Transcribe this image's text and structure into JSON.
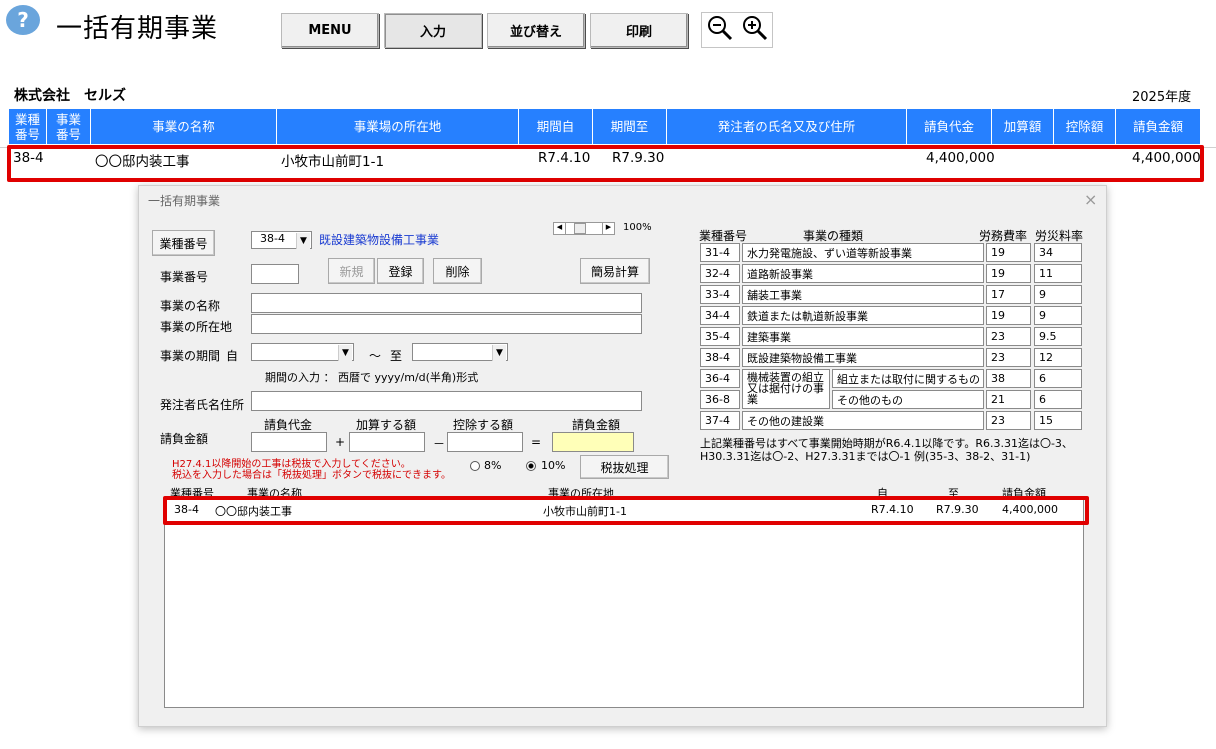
{
  "app": {
    "help_icon": "?",
    "title": "一括有期事業",
    "buttons": [
      "MENU",
      "入力",
      "並び替え",
      "印刷"
    ],
    "zoom_out_icon": "zoom-out-icon",
    "zoom_in_icon": "zoom-in-icon"
  },
  "company": "株式会社　セルズ",
  "fiscal_year": "2025年度",
  "table": {
    "headers": [
      "業種\n番号",
      "事業\n番号",
      "事業の名称",
      "事業場の所在地",
      "期間自",
      "期間至",
      "発注者の氏名又及び住所",
      "請負代金",
      "加算額",
      "控除額",
      "請負金額"
    ],
    "row": {
      "industry_no": "38-4",
      "business_name": "〇〇邸内装工事",
      "location": "小牧市山前町1-1",
      "from": "R7.4.10",
      "to": "R7.9.30",
      "contract_price": "4,400,000",
      "contract_amount": "4,400,000"
    }
  },
  "dialog": {
    "title": "一括有期事業",
    "close": "×",
    "industry_button": "業種番号",
    "industry_value": "38-4",
    "industry_name": "既設建築物設備工事業",
    "zoom_pct": "100%",
    "business_no_label": "事業番号",
    "new_button": "新規",
    "register_button": "登録",
    "delete_button": "削除",
    "simple_calc_button": "簡易計算",
    "name_label": "事業の名称",
    "location_label": "事業の所在地",
    "period_label": "事業の期間",
    "period_from": "自",
    "period_tilde": "～",
    "period_to": "至",
    "period_hint": "期間の入力 ：  西暦で  yyyy/m/d(半角)形式",
    "client_label": "発注者氏名住所",
    "amount_label": "請負金額",
    "col_contract": "請負代金",
    "col_add": "加算する額",
    "col_deduct": "控除する額",
    "col_total": "請負金額",
    "op_plus": "+",
    "op_minus": "－",
    "op_eq": "=",
    "tax_note_1": "H27.4.1以降開始の工事は税抜で入力してください。",
    "tax_note_2": "税込を入力した場合は「税抜処理」ボタンで税抜にできます。",
    "radio_8": "8%",
    "radio_10": "10%",
    "tax_button": "税抜処理",
    "code_table": {
      "headers": [
        "業種番号",
        "事業の種類",
        "労務費率",
        "労災料率"
      ],
      "rows": [
        {
          "code": "31-4",
          "name": "水力発電施設、ずい道等新設事業",
          "labor": "19",
          "rate": "34"
        },
        {
          "code": "32-4",
          "name": "道路新設事業",
          "labor": "19",
          "rate": "11"
        },
        {
          "code": "33-4",
          "name": "舗装工事業",
          "labor": "17",
          "rate": "9"
        },
        {
          "code": "34-4",
          "name": "鉄道または軌道新設事業",
          "labor": "19",
          "rate": "9"
        },
        {
          "code": "35-4",
          "name": "建築事業",
          "labor": "23",
          "rate": "9.5"
        },
        {
          "code": "38-4",
          "name": "既設建築物設備工事業",
          "labor": "23",
          "rate": "12"
        },
        {
          "code": "36-4",
          "name": "組立または取付に関するもの",
          "labor": "38",
          "rate": "6"
        },
        {
          "code": "36-8",
          "name": "その他のもの",
          "labor": "21",
          "rate": "6"
        },
        {
          "code": "37-4",
          "name": "その他の建設業",
          "labor": "23",
          "rate": "15"
        }
      ],
      "group_label": "機械装置の組立又は据付けの事業"
    },
    "note": "上記業種番号はすべて事業開始時期がR6.4.1以降です。R6.3.31迄は〇-3、H30.3.31迄は〇-2、H27.3.31までは〇-1  例(35-3、38-2、31-1)",
    "list": {
      "headers": [
        "業種番号",
        "事業の名称",
        "事業の所在地",
        "自",
        "至",
        "請負金額"
      ],
      "row": [
        "38-4",
        "〇〇邸内装工事",
        "小牧市山前町1-1",
        "R7.4.10",
        "R7.9.30",
        "4,400,000"
      ]
    }
  }
}
